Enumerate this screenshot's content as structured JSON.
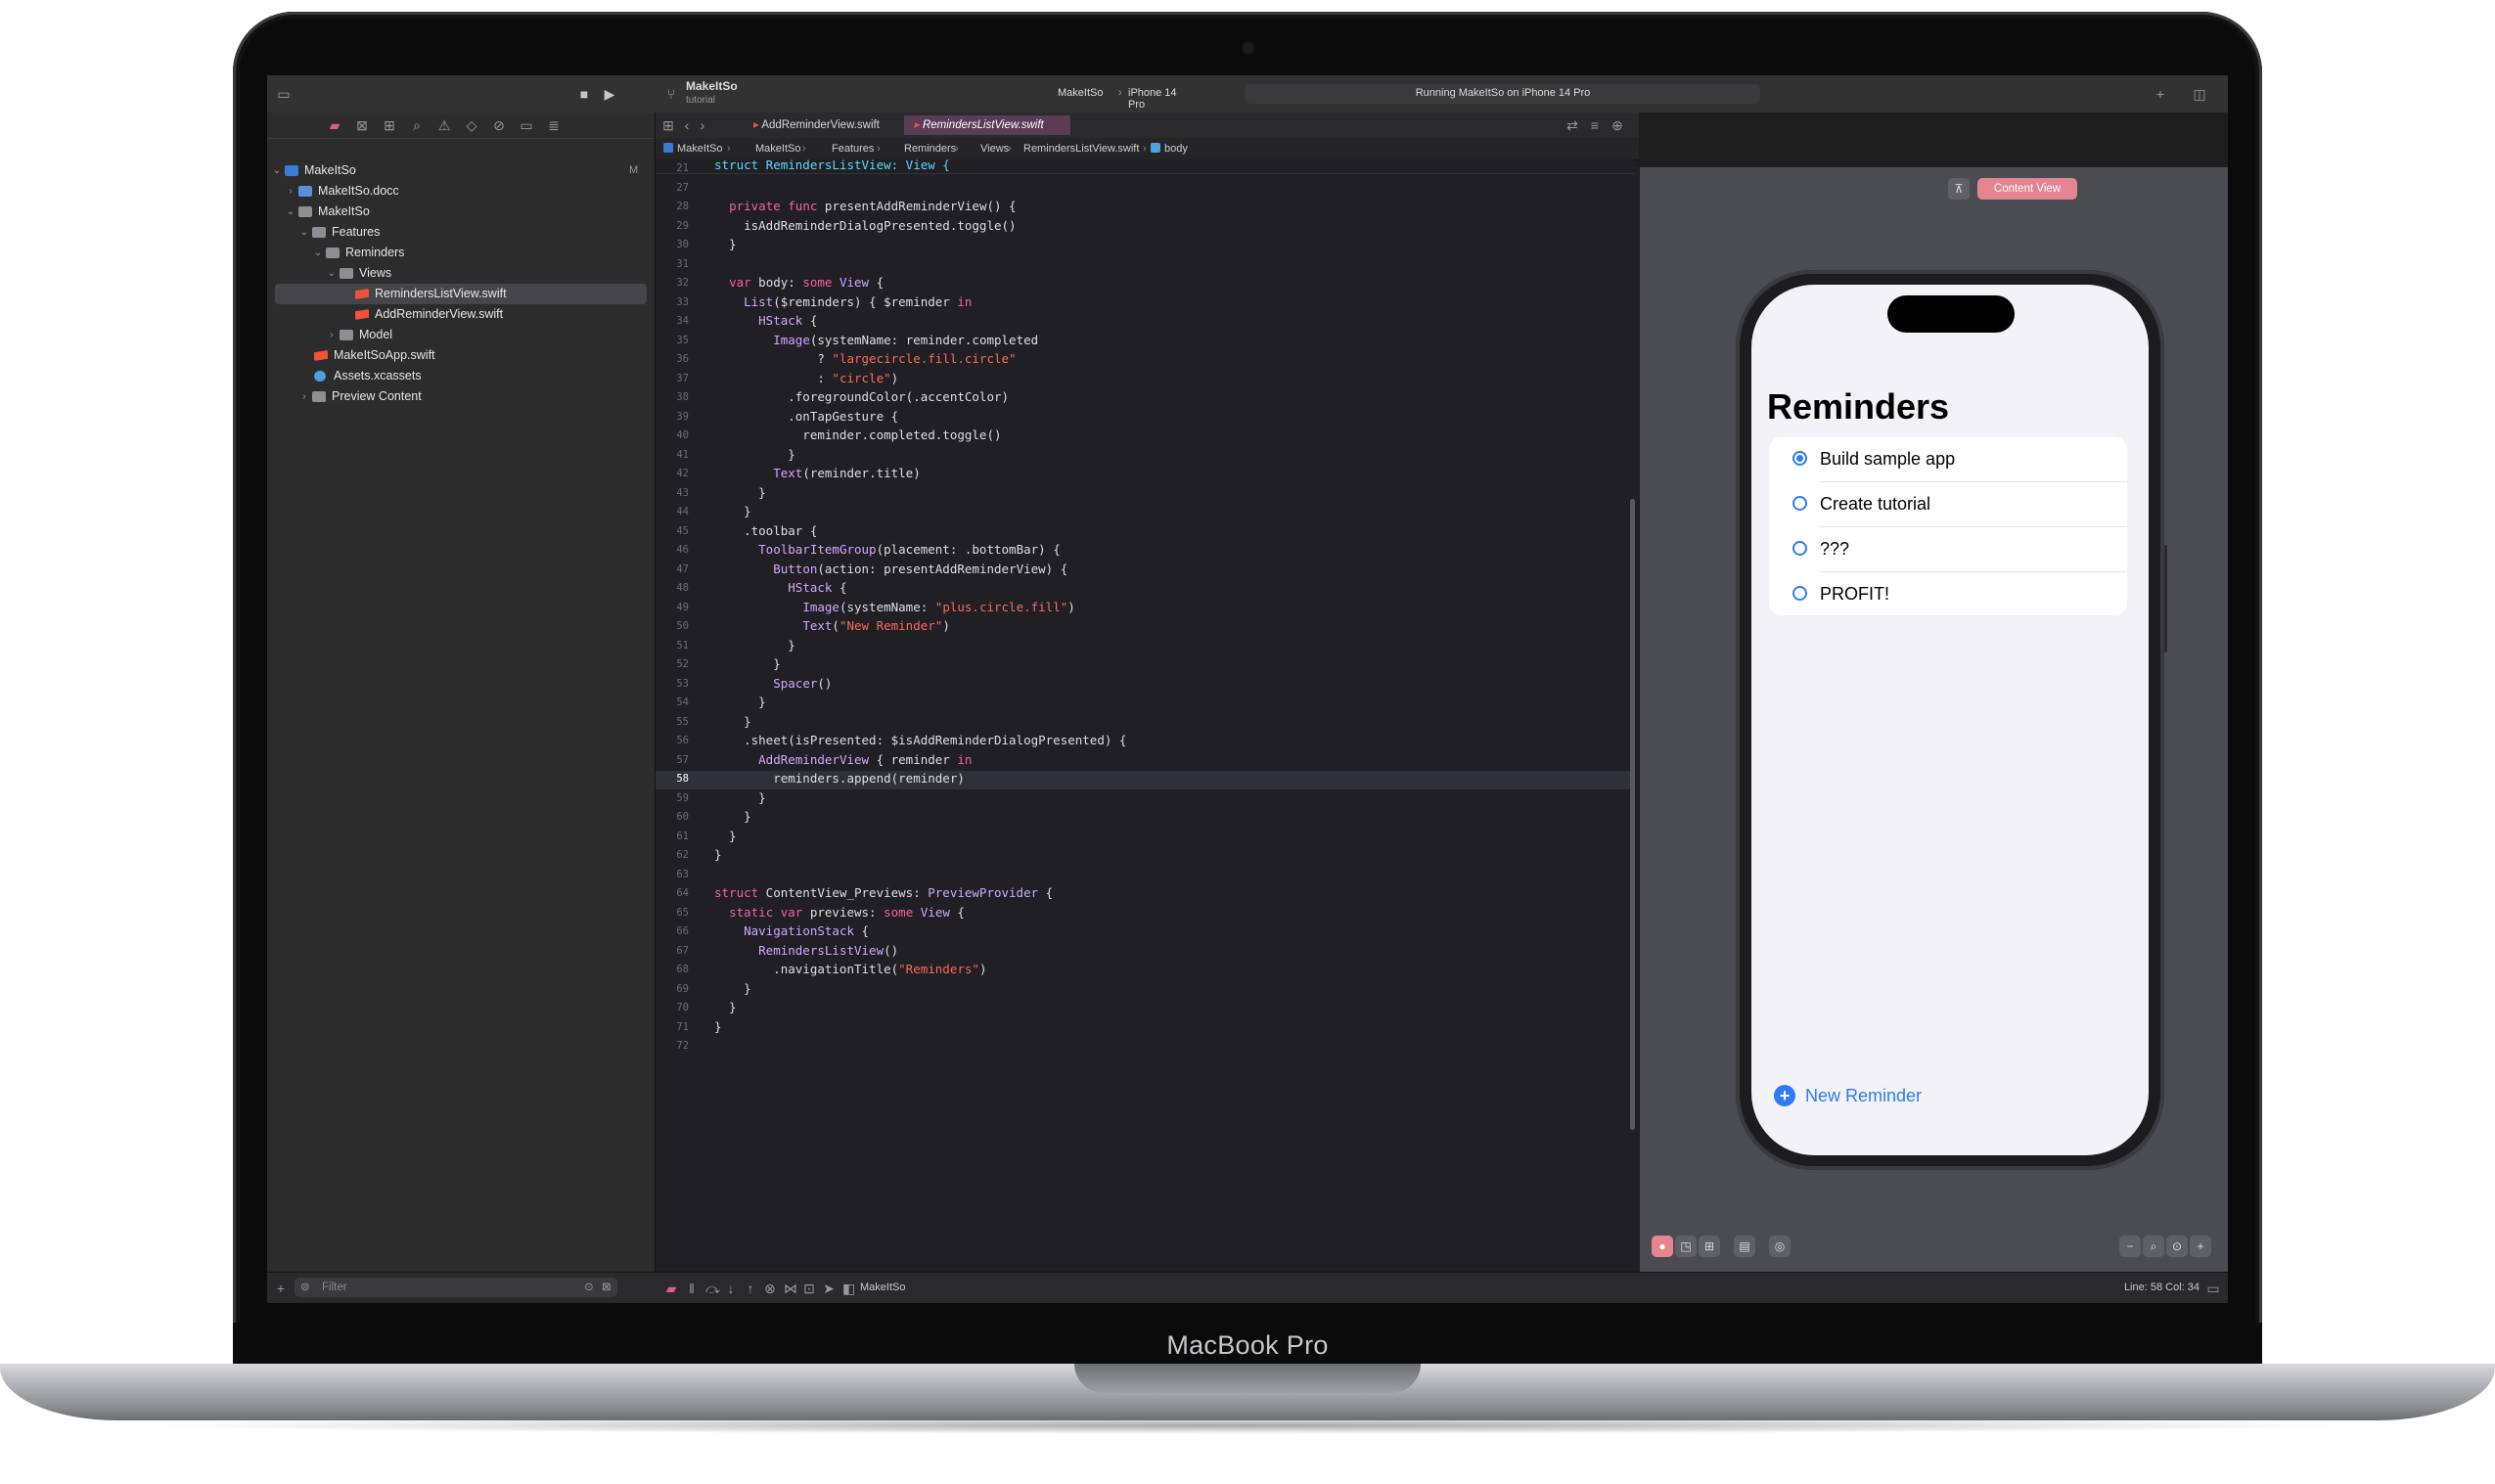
{
  "hardware": {
    "label": "MacBook Pro"
  },
  "toolbar": {
    "project_name": "MakeItSo",
    "branch": "tutorial",
    "scheme": "MakeItSo",
    "destination": "iPhone 14 Pro",
    "status": "Running MakeItSo on iPhone 14 Pro"
  },
  "navigator": {
    "items": [
      {
        "label": "MakeItSo",
        "badge": "M"
      },
      {
        "label": "MakeItSo.docc"
      },
      {
        "label": "MakeItSo"
      },
      {
        "label": "Features"
      },
      {
        "label": "Reminders"
      },
      {
        "label": "Views"
      },
      {
        "label": "RemindersListView.swift"
      },
      {
        "label": "AddReminderView.swift"
      },
      {
        "label": "Model"
      },
      {
        "label": "MakeItSoApp.swift"
      },
      {
        "label": "Assets.xcassets"
      },
      {
        "label": "Preview Content"
      }
    ],
    "filter_placeholder": "Filter"
  },
  "editor": {
    "tabs": [
      "AddReminderView.swift",
      "RemindersListView.swift"
    ],
    "breadcrumb": [
      "MakeItSo",
      "MakeItSo",
      "Features",
      "Reminders",
      "Views",
      "RemindersListView.swift",
      "body"
    ],
    "sticky_header": "struct RemindersListView: View {",
    "lines": [
      {
        "n": "21",
        "text": ""
      },
      {
        "n": "27",
        "text": ""
      },
      {
        "n": "28",
        "text": "  private func presentAddReminderView() {"
      },
      {
        "n": "29",
        "text": "    isAddReminderDialogPresented.toggle()"
      },
      {
        "n": "30",
        "text": "  }"
      },
      {
        "n": "31",
        "text": ""
      },
      {
        "n": "32",
        "text": "  var body: some View {"
      },
      {
        "n": "33",
        "text": "    List($reminders) { $reminder in"
      },
      {
        "n": "34",
        "text": "      HStack {"
      },
      {
        "n": "35",
        "text": "        Image(systemName: reminder.completed"
      },
      {
        "n": "36",
        "text": "              ? \"largecircle.fill.circle\""
      },
      {
        "n": "37",
        "text": "              : \"circle\")"
      },
      {
        "n": "38",
        "text": "          .foregroundColor(.accentColor)"
      },
      {
        "n": "39",
        "text": "          .onTapGesture {"
      },
      {
        "n": "40",
        "text": "            reminder.completed.toggle()"
      },
      {
        "n": "41",
        "text": "          }"
      },
      {
        "n": "42",
        "text": "        Text(reminder.title)"
      },
      {
        "n": "43",
        "text": "      }"
      },
      {
        "n": "44",
        "text": "    }"
      },
      {
        "n": "45",
        "text": "    .toolbar {"
      },
      {
        "n": "46",
        "text": "      ToolbarItemGroup(placement: .bottomBar) {"
      },
      {
        "n": "47",
        "text": "        Button(action: presentAddReminderView) {"
      },
      {
        "n": "48",
        "text": "          HStack {"
      },
      {
        "n": "49",
        "text": "            Image(systemName: \"plus.circle.fill\")"
      },
      {
        "n": "50",
        "text": "            Text(\"New Reminder\")"
      },
      {
        "n": "51",
        "text": "          }"
      },
      {
        "n": "52",
        "text": "        }"
      },
      {
        "n": "53",
        "text": "        Spacer()"
      },
      {
        "n": "54",
        "text": "      }"
      },
      {
        "n": "55",
        "text": "    }"
      },
      {
        "n": "56",
        "text": "    .sheet(isPresented: $isAddReminderDialogPresented) {"
      },
      {
        "n": "57",
        "text": "      AddReminderView { reminder in"
      },
      {
        "n": "58",
        "text": "        reminders.append(reminder)"
      },
      {
        "n": "59",
        "text": "      }"
      },
      {
        "n": "60",
        "text": "    }"
      },
      {
        "n": "61",
        "text": "  }"
      },
      {
        "n": "62",
        "text": "}"
      },
      {
        "n": "63",
        "text": ""
      },
      {
        "n": "64",
        "text": "struct ContentView_Previews: PreviewProvider {"
      },
      {
        "n": "65",
        "text": "  static var previews: some View {"
      },
      {
        "n": "66",
        "text": "    NavigationStack {"
      },
      {
        "n": "67",
        "text": "      RemindersListView()"
      },
      {
        "n": "68",
        "text": "        .navigationTitle(\"Reminders\")"
      },
      {
        "n": "69",
        "text": "    }"
      },
      {
        "n": "70",
        "text": "  }"
      },
      {
        "n": "71",
        "text": "}"
      },
      {
        "n": "72",
        "text": ""
      }
    ],
    "current_line": "58"
  },
  "preview": {
    "chip_label": "Content View",
    "title": "Reminders",
    "reminders": [
      {
        "title": "Build sample app",
        "completed": true
      },
      {
        "title": "Create tutorial",
        "completed": false
      },
      {
        "title": "???",
        "completed": false
      },
      {
        "title": "PROFIT!",
        "completed": false
      }
    ],
    "new_reminder_label": "New Reminder"
  },
  "statusbar": {
    "debug_target": "MakeItSo",
    "cursor_position": "Line: 58  Col: 34"
  },
  "colors": {
    "accent": "#2f7bf5",
    "active_tab": "#5a3c54",
    "preview_chip": "#e5858f"
  }
}
